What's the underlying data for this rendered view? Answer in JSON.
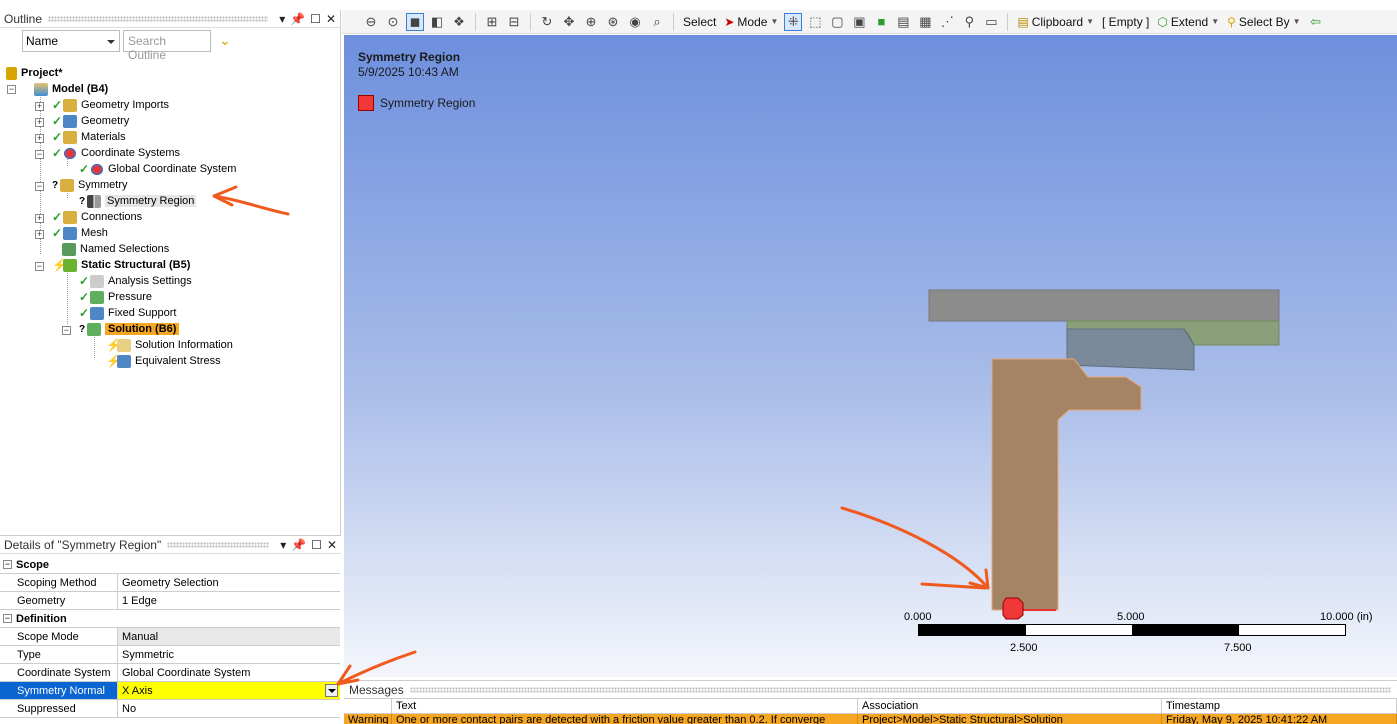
{
  "outline": {
    "title": "Outline",
    "filter_select": "Name",
    "search_placeholder": "Search Outline",
    "tree": [
      {
        "label": "Project*",
        "bold": true
      },
      {
        "label": "Model (B4)",
        "bold": true
      },
      {
        "label": "Geometry Imports"
      },
      {
        "label": "Geometry"
      },
      {
        "label": "Materials"
      },
      {
        "label": "Coordinate Systems"
      },
      {
        "label": "Global Coordinate System"
      },
      {
        "label": "Symmetry"
      },
      {
        "label": "Symmetry Region",
        "selected": true
      },
      {
        "label": "Connections"
      },
      {
        "label": "Mesh"
      },
      {
        "label": "Named Selections"
      },
      {
        "label": "Static Structural (B5)",
        "bold": true
      },
      {
        "label": "Analysis Settings"
      },
      {
        "label": "Pressure"
      },
      {
        "label": "Fixed Support"
      },
      {
        "label": "Solution (B6)",
        "highlight": true
      },
      {
        "label": "Solution Information"
      },
      {
        "label": "Equivalent Stress"
      }
    ]
  },
  "details": {
    "title": "Details of \"Symmetry Region\"",
    "sections": [
      {
        "name": "Scope",
        "rows": [
          {
            "key": "Scoping Method",
            "value": "Geometry Selection"
          },
          {
            "key": "Geometry",
            "value": "1 Edge"
          }
        ]
      },
      {
        "name": "Definition",
        "rows": [
          {
            "key": "Scope Mode",
            "value": "Manual"
          },
          {
            "key": "Type",
            "value": "Symmetric"
          },
          {
            "key": "Coordinate System",
            "value": "Global Coordinate System"
          },
          {
            "key": "Symmetry Normal",
            "value": "X Axis"
          },
          {
            "key": "Suppressed",
            "value": "No"
          }
        ]
      }
    ]
  },
  "toolbar": {
    "select": "Select",
    "mode": "Mode",
    "clipboard": "Clipboard",
    "empty": "[ Empty ]",
    "extend": "Extend",
    "select_by": "Select By"
  },
  "viewport": {
    "title": "Symmetry Region",
    "date": "5/9/2025 10:43 AM",
    "legend": "Symmetry Region",
    "scale_top": [
      "0.000",
      "5.000",
      "10.000 (in)"
    ],
    "scale_bottom": [
      "2.500",
      "7.500"
    ]
  },
  "messages": {
    "title": "Messages",
    "columns": [
      "",
      "Text",
      "Association",
      "Timestamp"
    ],
    "row": {
      "type": "Warning",
      "text": "One or more contact pairs are detected with a friction value greater than 0.2. If converge",
      "association": "Project>Model>Static Structural>Solution",
      "timestamp": "Friday, May 9, 2025 10:41:22 AM"
    }
  },
  "colors": {
    "accent_select": "#0a64d2",
    "highlight": "#ffff00",
    "solution": "#f5a623",
    "symmetry": "#f03838",
    "annotation": "#f05a1e"
  }
}
